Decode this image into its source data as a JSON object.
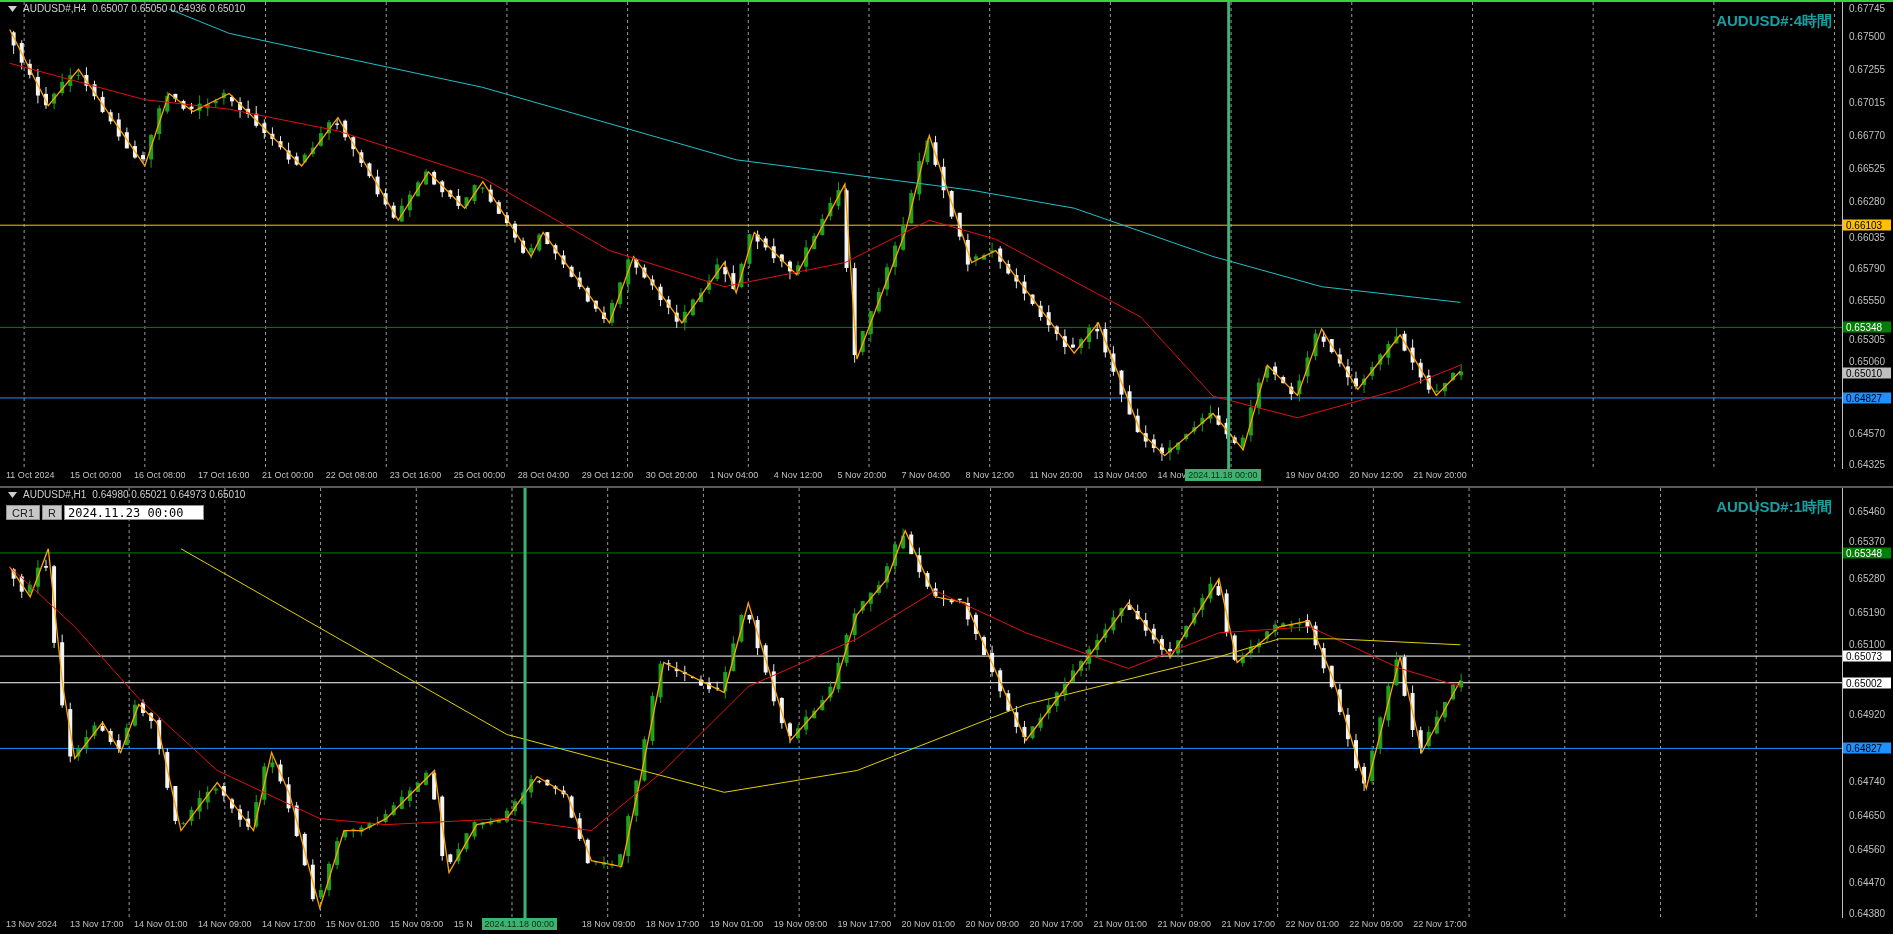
{
  "panels": [
    {
      "active": true,
      "header": {
        "symbol": "AUDUSD#,H4",
        "quote": "0.65007 0.65050 0.64936 0.65010"
      },
      "title": "AUDUSD#:4時間",
      "price_ticks": [
        "0.67745",
        "0.67500",
        "0.67255",
        "0.67015",
        "0.66770",
        "0.66525",
        "0.66280",
        "0.66035",
        "0.65790",
        "0.65550",
        "0.65305",
        "0.65060",
        "0.64570",
        "0.64325"
      ],
      "price_tags": [
        {
          "text": "0.66103",
          "color": "#ffc000",
          "kind": "level"
        },
        {
          "text": "0.65348",
          "color": "#008000",
          "kind": "level"
        },
        {
          "text": "0.65010",
          "color": "#c0c0c0",
          "kind": "price"
        },
        {
          "text": "0.64827",
          "color": "#1e90ff",
          "kind": "level"
        }
      ],
      "time_axis": [
        {
          "text": "11 Oct 2024",
          "kind": "tick"
        },
        {
          "text": "15 Oct 00:00",
          "kind": "tick"
        },
        {
          "text": "16 Oct 08:00",
          "kind": "tick"
        },
        {
          "text": "17 Oct 16:00",
          "kind": "tick"
        },
        {
          "text": "21 Oct 00:00",
          "kind": "tick"
        },
        {
          "text": "22 Oct 08:00",
          "kind": "tick"
        },
        {
          "text": "23 Oct 16:00",
          "kind": "tick"
        },
        {
          "text": "25 Oct 00:00",
          "kind": "tick"
        },
        {
          "text": "28 Oct 04:00",
          "kind": "tick"
        },
        {
          "text": "29 Oct 12:00",
          "kind": "tick"
        },
        {
          "text": "30 Oct 20:00",
          "kind": "tick"
        },
        {
          "text": "1 Nov 04:00",
          "kind": "tick"
        },
        {
          "text": "4 Nov 12:00",
          "kind": "tick"
        },
        {
          "text": "5 Nov 20:00",
          "kind": "tick"
        },
        {
          "text": "7 Nov 04:00",
          "kind": "tick"
        },
        {
          "text": "8 Nov 12:00",
          "kind": "tick"
        },
        {
          "text": "11 Nov 20:00",
          "kind": "tick"
        },
        {
          "text": "13 Nov 04:00",
          "kind": "tick"
        },
        {
          "text": "14 Nov",
          "kind": "tick"
        },
        {
          "text": "2024.11.18 00:00",
          "kind": "cursor"
        },
        {
          "text": "19 Nov 04:00",
          "kind": "tick"
        },
        {
          "text": "20 Nov 12:00",
          "kind": "tick"
        },
        {
          "text": "21 Nov 20:00",
          "kind": "tick"
        }
      ]
    },
    {
      "active": false,
      "header": {
        "symbol": "AUDUSD#,H1",
        "quote": "0.64980 0.65021 0.64973 0.65010"
      },
      "controls": {
        "buttons": [
          "CR1",
          "R"
        ],
        "date": "2024.11.23 00:00"
      },
      "title": "AUDUSD#:1時間",
      "price_ticks": [
        "0.65460",
        "0.65370",
        "0.65280",
        "0.65190",
        "0.65100",
        "0.64920",
        "0.64740",
        "0.64650",
        "0.64560",
        "0.64470",
        "0.64380"
      ],
      "price_tags": [
        {
          "text": "0.65348",
          "color": "#008000",
          "kind": "level"
        },
        {
          "text": "0.65073",
          "color": "#ffffff",
          "kind": "level"
        },
        {
          "text": "0.65002",
          "color": "#ffffff",
          "kind": "level"
        },
        {
          "text": "0.64827",
          "color": "#1e90ff",
          "kind": "level"
        }
      ],
      "time_axis": [
        {
          "text": "13 Nov 2024",
          "kind": "tick"
        },
        {
          "text": "13 Nov 17:00",
          "kind": "tick"
        },
        {
          "text": "14 Nov 01:00",
          "kind": "tick"
        },
        {
          "text": "14 Nov 09:00",
          "kind": "tick"
        },
        {
          "text": "14 Nov 17:00",
          "kind": "tick"
        },
        {
          "text": "15 Nov 01:00",
          "kind": "tick"
        },
        {
          "text": "15 Nov 09:00",
          "kind": "tick"
        },
        {
          "text": "15 N",
          "kind": "tick"
        },
        {
          "text": "2024.11.18 00:00",
          "kind": "cursor"
        },
        {
          "text": "18 Nov 09:00",
          "kind": "tick"
        },
        {
          "text": "18 Nov 17:00",
          "kind": "tick"
        },
        {
          "text": "19 Nov 01:00",
          "kind": "tick"
        },
        {
          "text": "19 Nov 09:00",
          "kind": "tick"
        },
        {
          "text": "19 Nov 17:00",
          "kind": "tick"
        },
        {
          "text": "20 Nov 01:00",
          "kind": "tick"
        },
        {
          "text": "20 Nov 09:00",
          "kind": "tick"
        },
        {
          "text": "20 Nov 17:00",
          "kind": "tick"
        },
        {
          "text": "21 Nov 01:00",
          "kind": "tick"
        },
        {
          "text": "21 Nov 09:00",
          "kind": "tick"
        },
        {
          "text": "21 Nov 17:00",
          "kind": "tick"
        },
        {
          "text": "22 Nov 01:00",
          "kind": "tick"
        },
        {
          "text": "22 Nov 09:00",
          "kind": "tick"
        },
        {
          "text": "22 Nov 17:00",
          "kind": "tick"
        }
      ]
    }
  ]
}
